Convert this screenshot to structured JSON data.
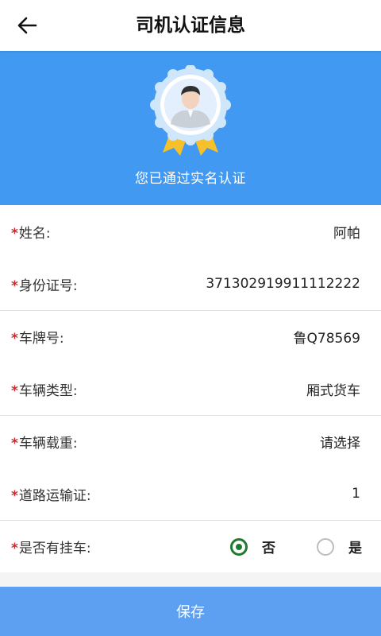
{
  "header": {
    "title": "司机认证信息",
    "back_icon": "arrow-left-icon"
  },
  "hero": {
    "status_text": "您已通过实名认证",
    "badge_icon": "verified-avatar-badge-icon",
    "background_color": "#4199f2"
  },
  "form": {
    "required_mark": "*",
    "name": {
      "label": "姓名:",
      "value": "阿帕"
    },
    "id_number": {
      "label": "身份证号:",
      "value": "371302919911112222"
    },
    "plate": {
      "label": "车牌号:",
      "value": "鲁Q78569"
    },
    "vehicle_type": {
      "label": "车辆类型:",
      "value": "厢式货车"
    },
    "vehicle_load": {
      "label": "车辆载重:",
      "value": "请选择"
    },
    "road_permit": {
      "label": "道路运输证:",
      "value": "1"
    },
    "trailer": {
      "label": "是否有挂车:",
      "options": [
        {
          "label": "否",
          "selected": true
        },
        {
          "label": "是",
          "selected": false
        }
      ]
    }
  },
  "footer": {
    "save_label": "保存",
    "button_color": "#5d9ff0"
  },
  "colors": {
    "required": "#d32626",
    "radio_checked": "#1f7a2e"
  }
}
